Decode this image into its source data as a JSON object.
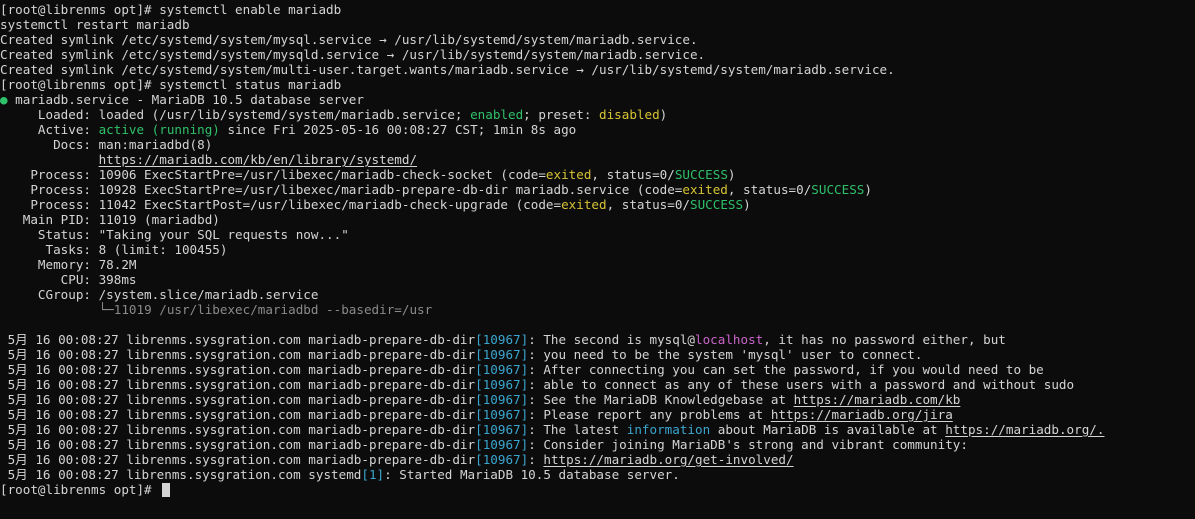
{
  "terminal": {
    "lines": [
      {
        "segs": [
          {
            "t": "[root@librenms opt]# systemctl enable mariadb"
          }
        ]
      },
      {
        "segs": [
          {
            "t": "systemctl restart mariadb"
          }
        ]
      },
      {
        "segs": [
          {
            "t": "Created symlink /etc/systemd/system/mysql.service → /usr/lib/systemd/system/mariadb.service."
          }
        ]
      },
      {
        "segs": [
          {
            "t": "Created symlink /etc/systemd/system/mysqld.service → /usr/lib/systemd/system/mariadb.service."
          }
        ]
      },
      {
        "segs": [
          {
            "t": "Created symlink /etc/systemd/system/multi-user.target.wants/mariadb.service → /usr/lib/systemd/system/mariadb.service."
          }
        ]
      },
      {
        "segs": [
          {
            "t": "[root@librenms opt]# systemctl status mariadb"
          }
        ]
      },
      {
        "segs": [
          {
            "t": "●",
            "c": "green"
          },
          {
            "t": " mariadb.service - MariaDB 10.5 database server"
          }
        ]
      },
      {
        "segs": [
          {
            "t": "     Loaded: loaded (/usr/lib/systemd/system/mariadb.service; "
          },
          {
            "t": "enabled",
            "c": "green"
          },
          {
            "t": "; preset: "
          },
          {
            "t": "disabled",
            "c": "yellow"
          },
          {
            "t": ")"
          }
        ]
      },
      {
        "segs": [
          {
            "t": "     Active: "
          },
          {
            "t": "active (running)",
            "c": "green"
          },
          {
            "t": " since Fri 2025-05-16 00:08:27 CST; 1min 8s ago"
          }
        ]
      },
      {
        "segs": [
          {
            "t": "       Docs: man:mariadbd(8)"
          }
        ]
      },
      {
        "segs": [
          {
            "t": "             "
          },
          {
            "t": "https://mariadb.com/kb/en/library/systemd/",
            "u": true
          }
        ]
      },
      {
        "segs": [
          {
            "t": "    Process: 10906 ExecStartPre=/usr/libexec/mariadb-check-socket (code="
          },
          {
            "t": "exited",
            "c": "yellow"
          },
          {
            "t": ", status=0/"
          },
          {
            "t": "SUCCESS",
            "c": "green"
          },
          {
            "t": ")"
          }
        ]
      },
      {
        "segs": [
          {
            "t": "    Process: 10928 ExecStartPre=/usr/libexec/mariadb-prepare-db-dir mariadb.service (code="
          },
          {
            "t": "exited",
            "c": "yellow"
          },
          {
            "t": ", status=0/"
          },
          {
            "t": "SUCCESS",
            "c": "green"
          },
          {
            "t": ")"
          }
        ]
      },
      {
        "segs": [
          {
            "t": "    Process: 11042 ExecStartPost=/usr/libexec/mariadb-check-upgrade (code="
          },
          {
            "t": "exited",
            "c": "yellow"
          },
          {
            "t": ", status=0/"
          },
          {
            "t": "SUCCESS",
            "c": "green"
          },
          {
            "t": ")"
          }
        ]
      },
      {
        "segs": [
          {
            "t": "   Main PID: 11019 (mariadbd)"
          }
        ]
      },
      {
        "segs": [
          {
            "t": "     Status: \"Taking your SQL requests now...\""
          }
        ]
      },
      {
        "segs": [
          {
            "t": "      Tasks: 8 (limit: 100455)"
          }
        ]
      },
      {
        "segs": [
          {
            "t": "     Memory: 78.2M"
          }
        ]
      },
      {
        "segs": [
          {
            "t": "        CPU: 398ms"
          }
        ]
      },
      {
        "segs": [
          {
            "t": "     CGroup: /system.slice/mariadb.service"
          }
        ]
      },
      {
        "segs": [
          {
            "t": "             "
          },
          {
            "t": "└─11019 /usr/libexec/mariadbd --basedir=/usr",
            "c": "dim"
          }
        ]
      },
      {
        "segs": [
          {
            "t": ""
          }
        ]
      },
      {
        "segs": [
          {
            "t": " 5月 16 00:08:27 librenms.sysgration.com mariadb-prepare-db-dir"
          },
          {
            "t": "[10967]",
            "c": "cyan"
          },
          {
            "t": ": The second is mysql@"
          },
          {
            "t": "localhost",
            "c": "magenta"
          },
          {
            "t": ", it has no password either, but"
          }
        ]
      },
      {
        "segs": [
          {
            "t": " 5月 16 00:08:27 librenms.sysgration.com mariadb-prepare-db-dir"
          },
          {
            "t": "[10967]",
            "c": "cyan"
          },
          {
            "t": ": you need to be the system 'mysql' user to connect."
          }
        ]
      },
      {
        "segs": [
          {
            "t": " 5月 16 00:08:27 librenms.sysgration.com mariadb-prepare-db-dir"
          },
          {
            "t": "[10967]",
            "c": "cyan"
          },
          {
            "t": ": After connecting you can set the password, if you would need to be"
          }
        ]
      },
      {
        "segs": [
          {
            "t": " 5月 16 00:08:27 librenms.sysgration.com mariadb-prepare-db-dir"
          },
          {
            "t": "[10967]",
            "c": "cyan"
          },
          {
            "t": ": able to connect as any of these users with a password and without sudo"
          }
        ]
      },
      {
        "segs": [
          {
            "t": " 5月 16 00:08:27 librenms.sysgration.com mariadb-prepare-db-dir"
          },
          {
            "t": "[10967]",
            "c": "cyan"
          },
          {
            "t": ": See the MariaDB Knowledgebase at "
          },
          {
            "t": "https://mariadb.com/kb",
            "u": true
          }
        ]
      },
      {
        "segs": [
          {
            "t": " 5月 16 00:08:27 librenms.sysgration.com mariadb-prepare-db-dir"
          },
          {
            "t": "[10967]",
            "c": "cyan"
          },
          {
            "t": ": Please report any problems at "
          },
          {
            "t": "https://mariadb.org/jira",
            "u": true
          }
        ]
      },
      {
        "segs": [
          {
            "t": " 5月 16 00:08:27 librenms.sysgration.com mariadb-prepare-db-dir"
          },
          {
            "t": "[10967]",
            "c": "cyan"
          },
          {
            "t": ": The latest "
          },
          {
            "t": "information",
            "c": "cyan"
          },
          {
            "t": " about MariaDB is available at "
          },
          {
            "t": "https://mariadb.org/.",
            "u": true
          }
        ]
      },
      {
        "segs": [
          {
            "t": " 5月 16 00:08:27 librenms.sysgration.com mariadb-prepare-db-dir"
          },
          {
            "t": "[10967]",
            "c": "cyan"
          },
          {
            "t": ": Consider joining MariaDB's strong and vibrant community:"
          }
        ]
      },
      {
        "segs": [
          {
            "t": " 5月 16 00:08:27 librenms.sysgration.com mariadb-prepare-db-dir"
          },
          {
            "t": "[10967]",
            "c": "cyan"
          },
          {
            "t": ": "
          },
          {
            "t": "https://mariadb.org/get-involved/",
            "u": true
          }
        ]
      },
      {
        "segs": [
          {
            "t": " 5月 16 00:08:27 librenms.sysgration.com systemd"
          },
          {
            "t": "[1]",
            "c": "cyan"
          },
          {
            "t": ": Started MariaDB 10.5 database server."
          }
        ]
      },
      {
        "segs": [
          {
            "t": "[root@librenms opt]# "
          }
        ],
        "cursor": true
      }
    ]
  },
  "colors": {
    "background": "#0c0c0c",
    "foreground": "#d4d4d4",
    "green": "#2fc06a",
    "yellow": "#d7c434",
    "cyan": "#3aa6cf",
    "dim": "#8a8a8a",
    "magenta": "#c964c9"
  }
}
